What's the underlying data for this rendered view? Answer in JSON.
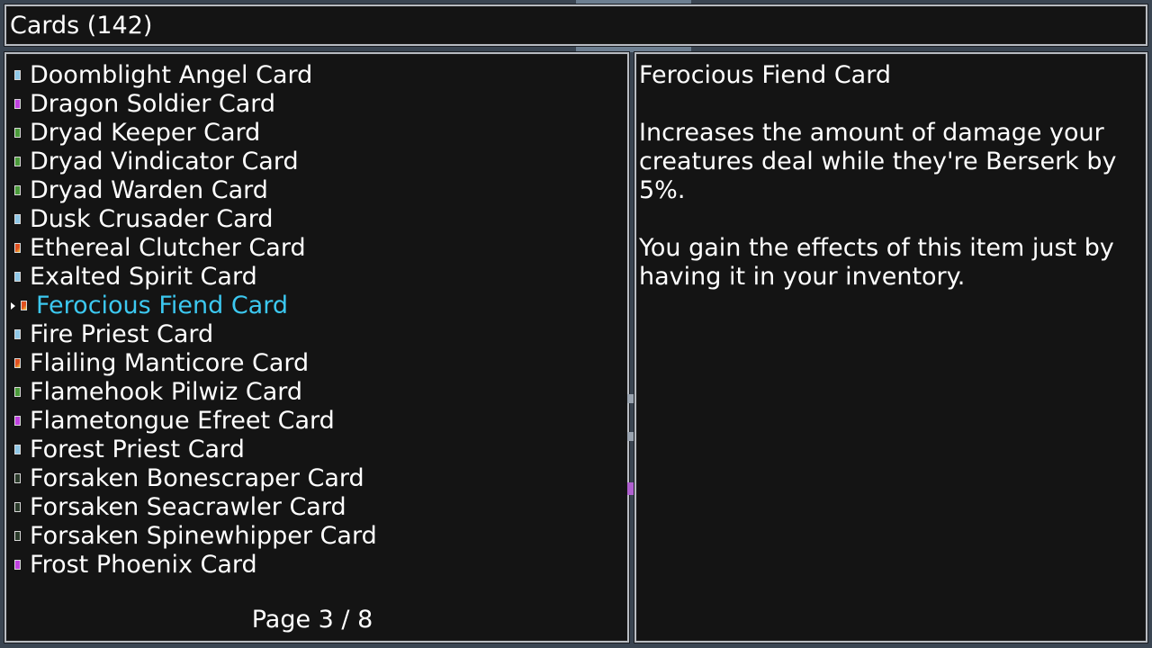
{
  "header": {
    "title": "Cards (142)"
  },
  "list": {
    "items": [
      {
        "label": "Doomblight Angel Card",
        "color": "#8fc8e8",
        "selected": false
      },
      {
        "label": "Dragon Soldier Card",
        "color": "#c040e0",
        "selected": false
      },
      {
        "label": "Dryad Keeper Card",
        "color": "#4a9a3a",
        "selected": false
      },
      {
        "label": "Dryad Vindicator Card",
        "color": "#4a9a3a",
        "selected": false
      },
      {
        "label": "Dryad Warden Card",
        "color": "#4a9a3a",
        "selected": false
      },
      {
        "label": "Dusk Crusader Card",
        "color": "#8fc8e8",
        "selected": false
      },
      {
        "label": "Ethereal Clutcher Card",
        "color": "#e05020",
        "selected": false
      },
      {
        "label": "Exalted Spirit Card",
        "color": "#8fc8e8",
        "selected": false
      },
      {
        "label": "Ferocious Fiend Card",
        "color": "#e05020",
        "selected": true
      },
      {
        "label": "Fire Priest Card",
        "color": "#8fc8e8",
        "selected": false
      },
      {
        "label": "Flailing Manticore Card",
        "color": "#e05020",
        "selected": false
      },
      {
        "label": "Flamehook Pilwiz Card",
        "color": "#4a9a3a",
        "selected": false
      },
      {
        "label": "Flametongue Efreet Card",
        "color": "#c040e0",
        "selected": false
      },
      {
        "label": "Forest Priest Card",
        "color": "#8fc8e8",
        "selected": false
      },
      {
        "label": "Forsaken Bonescraper Card",
        "color": "#2a3a2a",
        "selected": false
      },
      {
        "label": "Forsaken Seacrawler Card",
        "color": "#2a3a2a",
        "selected": false
      },
      {
        "label": "Forsaken Spinewhipper Card",
        "color": "#2a3a2a",
        "selected": false
      },
      {
        "label": "Frost Phoenix Card",
        "color": "#c040e0",
        "selected": false
      }
    ],
    "page": "Page 3 / 8"
  },
  "detail": {
    "title": "Ferocious Fiend Card",
    "description": "Increases the amount of damage your creatures deal while they're Berserk by 5%.",
    "note": "You gain the effects of this item just by having it in your inventory."
  },
  "colors": {
    "panel_bg": "#141414",
    "border": "#b8bcc2",
    "selected_text": "#3cc8f0",
    "text": "#ffffff"
  }
}
